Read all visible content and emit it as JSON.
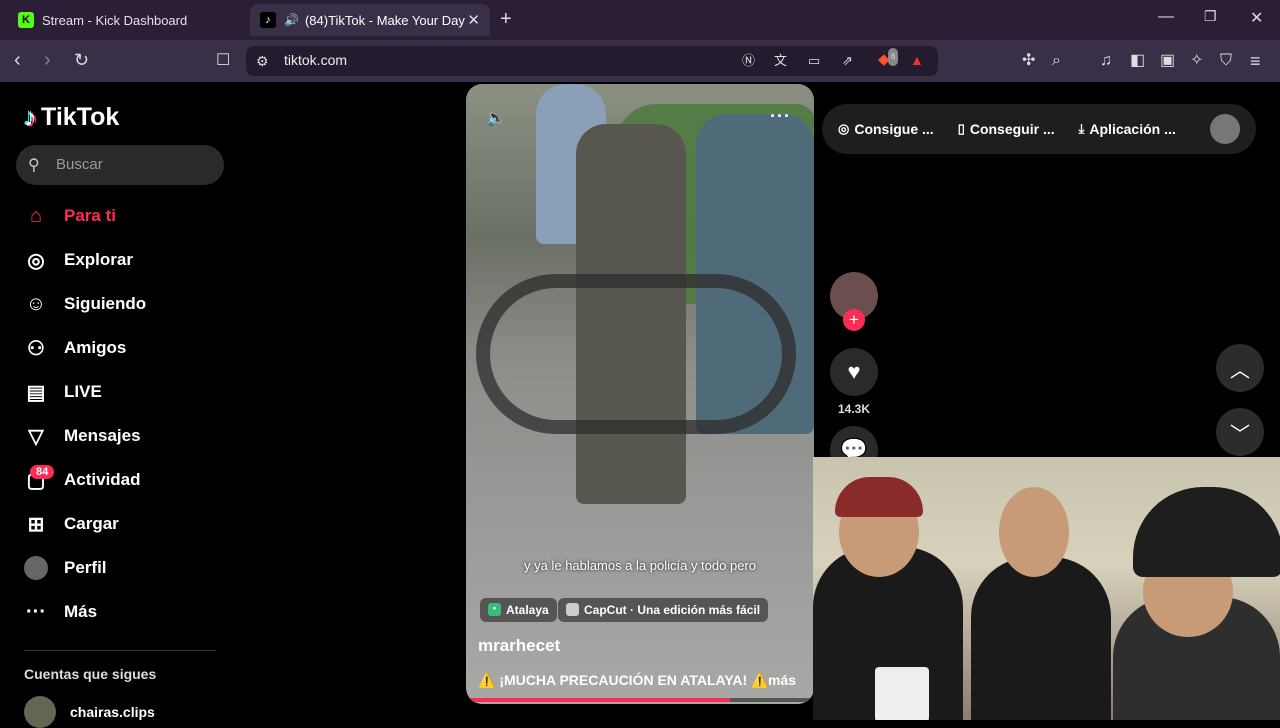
{
  "browser": {
    "tabs": [
      {
        "label": "Stream - Kick Dashboard",
        "favicon": "kick-icon"
      },
      {
        "label": "(84)TikTok - Make Your Day",
        "favicon": "tiktok-icon",
        "audio": true
      }
    ],
    "url": "tiktok.com",
    "brave_badge": "6"
  },
  "sidebar": {
    "logo": "TikTok",
    "search_placeholder": "Buscar",
    "nav": [
      {
        "label": "Para ti",
        "icon": "home-icon",
        "active": true
      },
      {
        "label": "Explorar",
        "icon": "compass-icon"
      },
      {
        "label": "Siguiendo",
        "icon": "following-icon"
      },
      {
        "label": "Amigos",
        "icon": "friends-icon"
      },
      {
        "label": "LIVE",
        "icon": "live-icon"
      },
      {
        "label": "Mensajes",
        "icon": "send-icon"
      },
      {
        "label": "Actividad",
        "icon": "activity-icon"
      },
      {
        "label": "Cargar",
        "icon": "upload-icon"
      },
      {
        "label": "Perfil",
        "icon": "avatar"
      },
      {
        "label": "Más",
        "icon": "more-icon"
      }
    ],
    "activity_badge": "84",
    "following_header": "Cuentas que sigues",
    "following": [
      {
        "name": "chairas.clips"
      }
    ]
  },
  "video": {
    "subtitle": "y ya le hablamos a la policía y todo pero",
    "chips": [
      "Atalaya",
      "CapCut · Una edición más fácil"
    ],
    "author": "mrarhecet",
    "description": "⚠️ ¡MUCHA PRECAUCIÓN EN ATALAYA! ⚠️",
    "more": "más",
    "progress": 0.76
  },
  "actions": {
    "likes": "14.3K"
  },
  "topbar": {
    "items": [
      "Consigue ...",
      "Conseguir ...",
      "Aplicación ..."
    ]
  },
  "colors": {
    "accent": "#fe2c55",
    "tab_bg": "#2a1f36",
    "addr_bg": "#3a2f48"
  }
}
